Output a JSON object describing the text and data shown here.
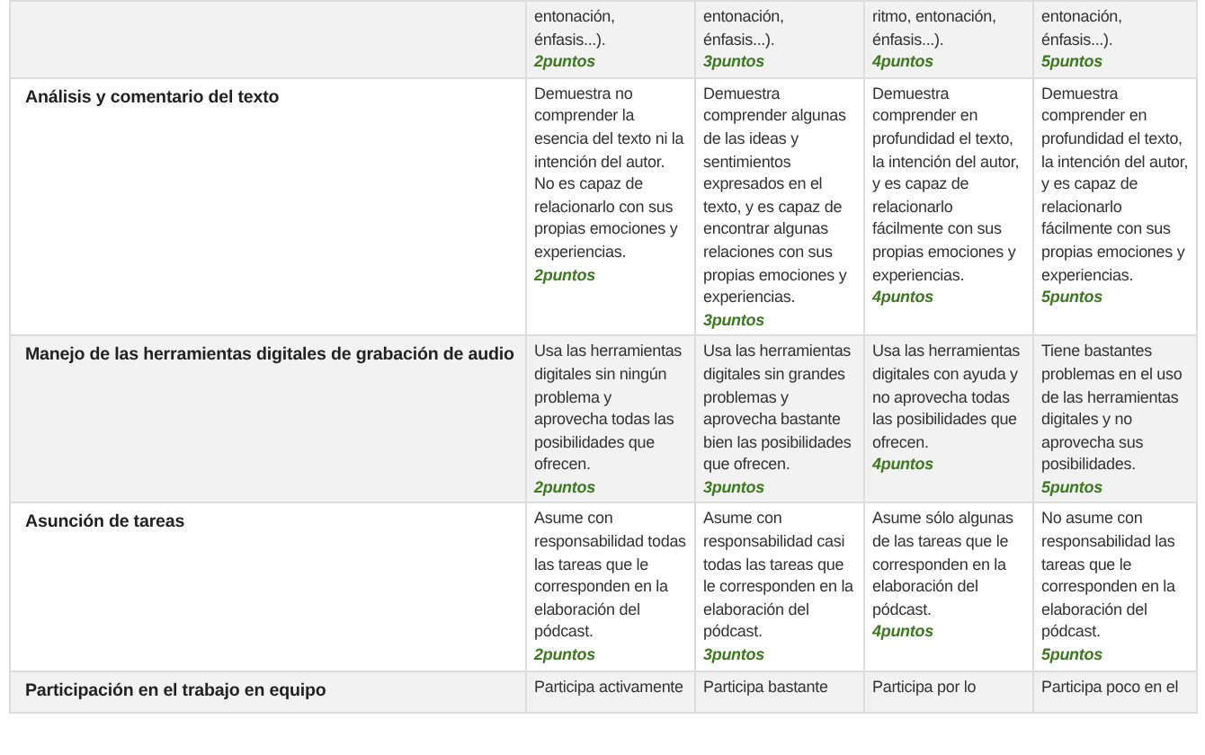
{
  "rubric": {
    "rows": [
      {
        "criterion": "",
        "cells": [
          {
            "text": "entonación, énfasis...).",
            "points": "2puntos"
          },
          {
            "text": "entonación, énfasis...).",
            "points": "3puntos"
          },
          {
            "text": "ritmo, entonación, énfasis...).",
            "points": "4puntos"
          },
          {
            "text": "entonación, énfasis...).",
            "points": "5puntos"
          }
        ]
      },
      {
        "criterion": "Análisis y comentario del texto",
        "cells": [
          {
            "text": "Demuestra no comprender la esencia del texto ni la intención del autor. No es capaz de relacionarlo con sus propias emociones y experiencias.",
            "points": "2puntos"
          },
          {
            "text": "Demuestra comprender algunas de las ideas y sentimientos expresados en el texto, y es capaz de encontrar algunas relaciones con sus propias emociones y experiencias.",
            "points": "3puntos"
          },
          {
            "text": "Demuestra comprender en profundidad el texto, la intención del autor, y es capaz de relacionarlo fácilmente con sus propias emociones y experiencias.",
            "points": "4puntos"
          },
          {
            "text": "Demuestra comprender en profundidad el texto, la intención del autor, y es capaz de relacionarlo fácilmente con sus propias emociones y experiencias.",
            "points": "5puntos"
          }
        ]
      },
      {
        "criterion": "Manejo de las herramientas digitales de grabación de audio",
        "cells": [
          {
            "text": "Usa las herramientas digitales sin ningún problema y aprovecha todas las posibilidades que ofrecen.",
            "points": "2puntos"
          },
          {
            "text": "Usa las herramientas digitales sin grandes problemas y aprovecha bastante bien las posibilidades que ofrecen.",
            "points": "3puntos"
          },
          {
            "text": "Usa las herramientas digitales con ayuda y no aprovecha todas las posibilidades que ofrecen.",
            "points": "4puntos"
          },
          {
            "text": "Tiene bastantes problemas en el uso de las herramientas digitales y no aprovecha sus posibilidades.",
            "points": "5puntos"
          }
        ]
      },
      {
        "criterion": "Asunción de tareas",
        "cells": [
          {
            "text": "Asume con responsabilidad todas las tareas que le corresponden en la elaboración del pódcast.",
            "points": "2puntos"
          },
          {
            "text": "Asume con responsabilidad casi todas las tareas que le corresponden en la elaboración del pódcast.",
            "points": "3puntos"
          },
          {
            "text": "Asume sólo algunas de las tareas que le corresponden en la elaboración del pódcast.",
            "points": "4puntos"
          },
          {
            "text": "No asume con responsabilidad las tareas que le corresponden en la elaboración del pódcast.",
            "points": "5puntos"
          }
        ]
      },
      {
        "criterion": "Participación en el trabajo en equipo",
        "cells": [
          {
            "text": "Participa activamente"
          },
          {
            "text": "Participa bastante"
          },
          {
            "text": "Participa por lo"
          },
          {
            "text": "Participa poco en el"
          }
        ]
      }
    ]
  }
}
